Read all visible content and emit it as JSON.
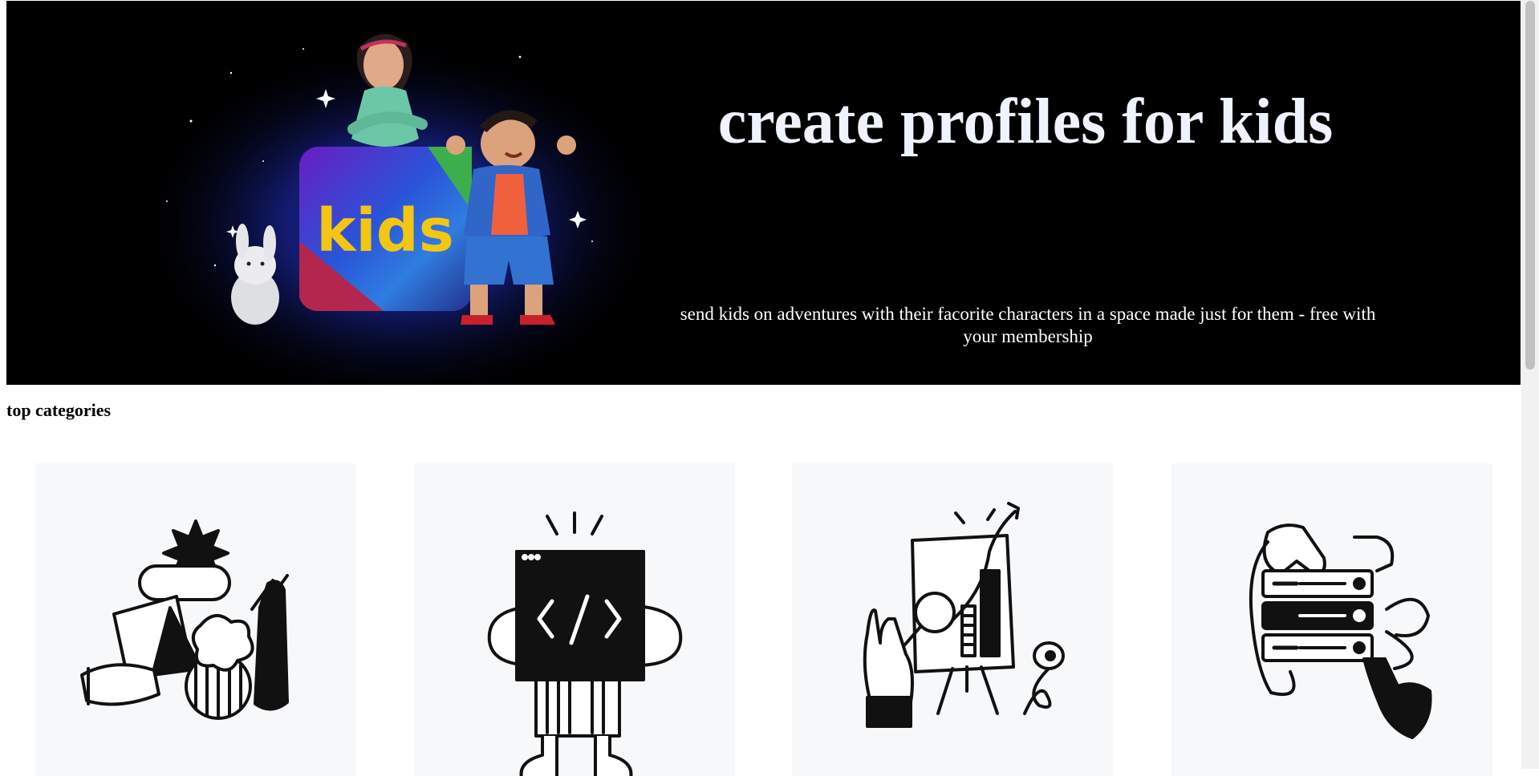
{
  "hero": {
    "title": "create profiles for kids",
    "subtitle": "send kids on adventures with their facorite characters in a space made just for them - free with your membership",
    "logo_text": "kids"
  },
  "sections": {
    "top_categories_title": "top categories"
  },
  "categories": [
    {
      "icon": "design-shapes-icon"
    },
    {
      "icon": "code-screen-icon"
    },
    {
      "icon": "presentation-chart-icon"
    },
    {
      "icon": "server-stack-icon"
    }
  ],
  "colors": {
    "hero_bg": "#000000",
    "card_bg": "#f7f8fa",
    "logo_yellow": "#f3c614",
    "title_text": "#eef3ff"
  }
}
